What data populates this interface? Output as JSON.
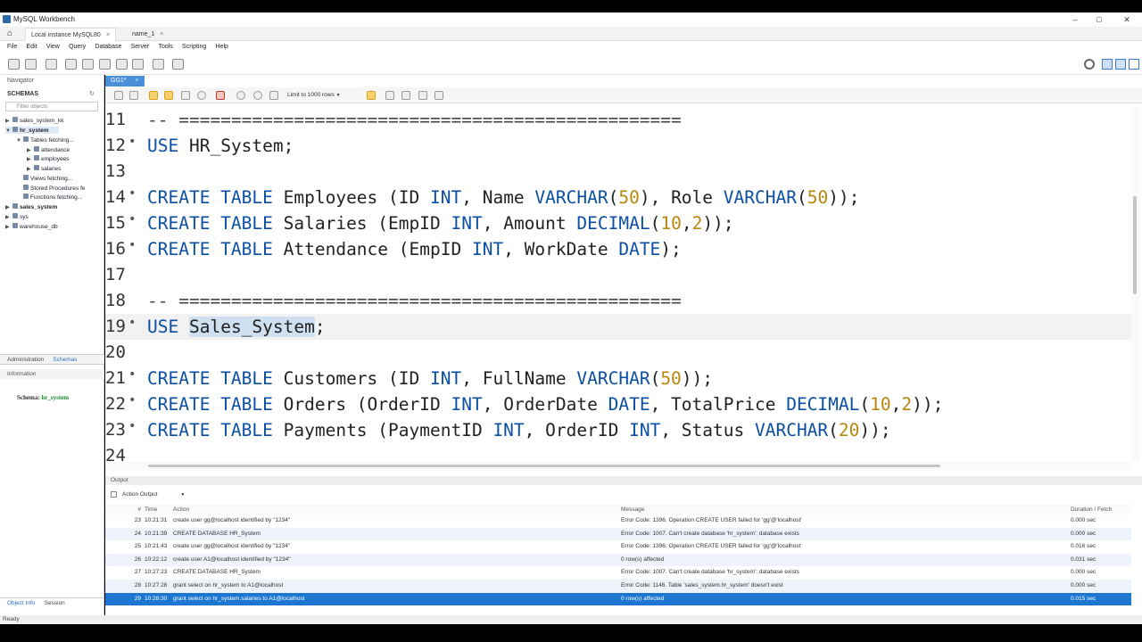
{
  "window": {
    "title": "MySQL Workbench"
  },
  "connection_tabs": [
    {
      "label": "Local instance MySQL80"
    },
    {
      "label": "name_1"
    }
  ],
  "menu": [
    "File",
    "Edit",
    "View",
    "Query",
    "Database",
    "Server",
    "Tools",
    "Scripting",
    "Help"
  ],
  "navigator": {
    "header": "Navigator",
    "section": "SCHEMAS",
    "filter_placeholder": "Filter objects",
    "schemas": {
      "s1": "sales_system_kk",
      "s2": "hr_system",
      "tables": "Tables fetching...",
      "t1": "attendance",
      "t2": "employees",
      "t3": "salaries",
      "views": "Views fetching...",
      "procs": "Stored Procedures fe",
      "funcs": "Functions fetching...",
      "s3": "sales_system",
      "s4": "sys",
      "s5": "warehouse_db"
    },
    "tab_admin": "Administration",
    "tab_schemas": "Schemas",
    "info_header": "Information",
    "schema_label": "Schema:",
    "schema_value": "hr_system",
    "tab_objinfo": "Object Info",
    "tab_session": "Session"
  },
  "editor": {
    "tab": "GG1*",
    "limit": "Limit to 1000 rows",
    "lines": {
      "l11": {
        "n": "11",
        "c": "-- ================================================"
      },
      "l12": {
        "n": "12",
        "k1": "USE",
        "t1": " HR_System;"
      },
      "l13": {
        "n": "13"
      },
      "l14": {
        "n": "14",
        "k1": "CREATE TABLE",
        "t1": " Employees (ID ",
        "k2": "INT",
        "t2": ", Name ",
        "k3": "VARCHAR",
        "t3": "(",
        "n1": "50",
        "t4": "), Role ",
        "k4": "VARCHAR",
        "t5": "(",
        "n2": "50",
        "t6": "));"
      },
      "l15": {
        "n": "15",
        "k1": "CREATE TABLE",
        "t1": " Salaries (EmpID ",
        "k2": "INT",
        "t2": ", Amount ",
        "k3": "DECIMAL",
        "t3": "(",
        "n1": "10",
        "t4": ",",
        "n2": "2",
        "t5": "));"
      },
      "l16": {
        "n": "16",
        "k1": "CREATE TABLE",
        "t1": " Attendance (EmpID ",
        "k2": "INT",
        "t2": ", WorkDate ",
        "k3": "DATE",
        "t3": ");"
      },
      "l17": {
        "n": "17"
      },
      "l18": {
        "n": "18",
        "c": "-- ================================================"
      },
      "l19": {
        "n": "19",
        "k1": "USE",
        "t0": " ",
        "s1": "Sales_System",
        "t1": ";"
      },
      "l20": {
        "n": "20"
      },
      "l21": {
        "n": "21",
        "k1": "CREATE TABLE",
        "t1": " Customers (ID ",
        "k2": "INT",
        "t2": ", FullName ",
        "k3": "VARCHAR",
        "t3": "(",
        "n1": "50",
        "t4": "));"
      },
      "l22": {
        "n": "22",
        "k1": "CREATE TABLE",
        "t1": " Orders (OrderID ",
        "k2": "INT",
        "t2": ", OrderDate ",
        "k3": "DATE",
        "t3": ", TotalPrice ",
        "k4": "DECIMAL",
        "t4": "(",
        "n1": "10",
        "t5": ",",
        "n2": "2",
        "t6": "));"
      },
      "l23": {
        "n": "23",
        "k1": "CREATE TABLE",
        "t1": " Payments (PaymentID ",
        "k2": "INT",
        "t2": ", OrderID ",
        "k3": "INT",
        "t3": ", Status ",
        "k4": "VARCHAR",
        "t4": "(",
        "n1": "20",
        "t5": "));"
      },
      "l24": {
        "n": "24"
      }
    }
  },
  "output": {
    "header": "Output",
    "selector": "Action Output",
    "columns": {
      "no": "#",
      "time": "Time",
      "action": "Action",
      "message": "Message",
      "duration": "Duration / Fetch"
    },
    "rows": [
      {
        "status": "error",
        "no": "23",
        "time": "10:21:31",
        "action": "create user gg@localhost identified by \"1234\"",
        "message": "Error Code: 1396. Operation CREATE USER failed for 'gg'@'localhost'",
        "duration": "0.000 sec"
      },
      {
        "status": "error",
        "no": "24",
        "time": "10:21:39",
        "action": "CREATE DATABASE HR_System",
        "message": "Error Code: 1007. Can't create database 'hr_system'; database exists",
        "duration": "0.000 sec"
      },
      {
        "status": "error",
        "no": "25",
        "time": "10:21:43",
        "action": "create user gg@localhost identified by \"1234\"",
        "message": "Error Code: 1396. Operation CREATE USER failed for 'gg'@'localhost'",
        "duration": "0.016 sec"
      },
      {
        "status": "ok",
        "no": "26",
        "time": "10:22:12",
        "action": "create user A1@localhost identified by \"1234\"",
        "message": "0 row(s) affected",
        "duration": "0.031 sec"
      },
      {
        "status": "error",
        "no": "27",
        "time": "10:27:23",
        "action": "CREATE DATABASE HR_System",
        "message": "Error Code: 1007. Can't create database 'hr_system'; database exists",
        "duration": "0.000 sec"
      },
      {
        "status": "error",
        "no": "28",
        "time": "10:27:28",
        "action": "grant select on hr_system to A1@localhost",
        "message": "Error Code: 1146. Table 'sales_system.hr_system' doesn't exist",
        "duration": "0.000 sec"
      },
      {
        "status": "ok",
        "no": "29",
        "time": "10:28:30",
        "action": "grant select on hr_system.salaries to A1@localhost",
        "message": "0 row(s) affected",
        "duration": "0.015 sec"
      }
    ]
  },
  "statusbar": {
    "text": "Ready"
  }
}
